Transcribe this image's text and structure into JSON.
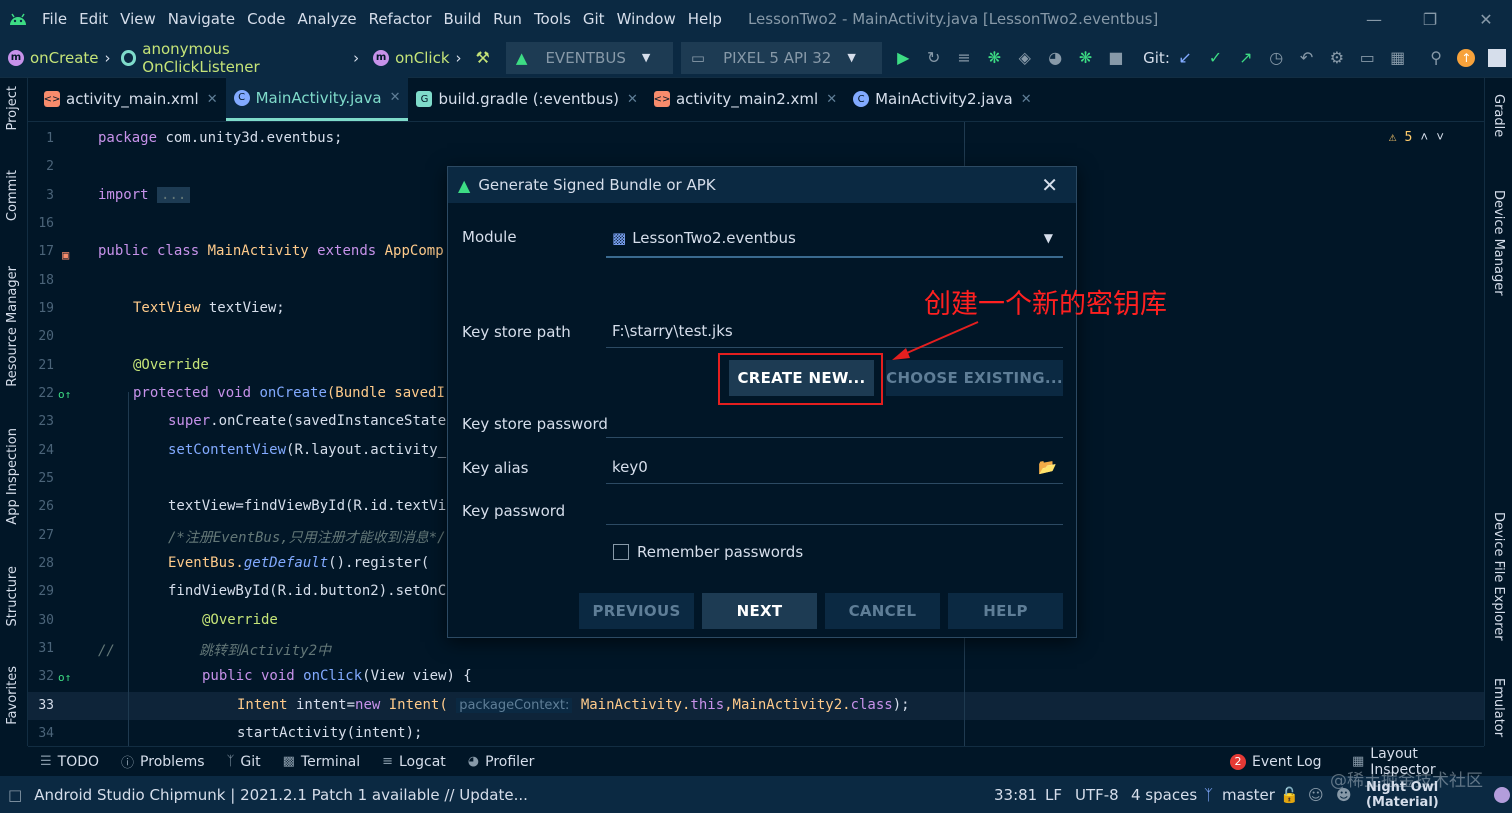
{
  "menubar": {
    "items": [
      "File",
      "Edit",
      "View",
      "Navigate",
      "Code",
      "Analyze",
      "Refactor",
      "Build",
      "Run",
      "Tools",
      "Git",
      "Window",
      "Help"
    ],
    "title": "LessonTwo2 - MainActivity.java [LessonTwo2.eventbus]"
  },
  "toolbar": {
    "crumbs": [
      "onCreate",
      "anonymous OnClickListener",
      "onClick"
    ],
    "run_config": "EVENTBUS",
    "device": "PIXEL 5 API 32",
    "git_label": "Git:"
  },
  "tabs": [
    {
      "label": "activity_main.xml",
      "type": "xml"
    },
    {
      "label": "MainActivity.java",
      "type": "java",
      "active": true
    },
    {
      "label": "build.gradle (:eventbus)",
      "type": "gradle"
    },
    {
      "label": "activity_main2.xml",
      "type": "xml"
    },
    {
      "label": "MainActivity2.java",
      "type": "java"
    }
  ],
  "left_tools": [
    "Project",
    "Commit",
    "Resource Manager",
    "App Inspection",
    "Structure",
    "Favorites"
  ],
  "right_tools": [
    "Gradle",
    "Device Manager",
    "Device File Explorer",
    "Emulator"
  ],
  "editor": {
    "warnings": "5",
    "line_numbers": [
      "1",
      "2",
      "3",
      "16",
      "17",
      "18",
      "19",
      "20",
      "21",
      "22",
      "23",
      "24",
      "25",
      "26",
      "27",
      "28",
      "29",
      "30",
      "31",
      "32",
      "33",
      "34"
    ],
    "lines": {
      "l1_kw": "package",
      "l1_rest": " com.unity3d.eventbus;",
      "l3_kw": "import",
      "l3_fold": "...",
      "l17_kw": "public class",
      "l17_name": " MainActivity ",
      "l17_ext": "extends",
      "l17_rest": " AppComp",
      "l19_type": "TextView",
      "l19_rest": " textView;",
      "l21_ann": "@Override",
      "l22_kw": "protected void",
      "l22_fn": " onCreate",
      "l22_rest": "(Bundle savedI",
      "l23_kw": "super",
      "l23_rest": ".onCreate(savedInstanceState",
      "l24_fn": "setContentView",
      "l24_rest": "(R.layout.activity_",
      "l26_rest": "textView=findViewById(R.id.textVi",
      "l27_cm": "/*注册EventBus,只用注册才能收到消息*/",
      "l28_rest": "EventBus.",
      "l28_it": "getDefault",
      "l28_rest2": "().register(",
      "l29_rest": "findViewById(R.id.button2).setOnC",
      "l30_ann": "@Override",
      "l31_cm": "//          跳转到Activity2中",
      "l32_kw": "public void",
      "l32_fn": " onClick",
      "l32_rest": "(View view) {",
      "l33_type": "Intent",
      "l33_mid": " intent=",
      "l33_new": "new",
      "l33_type2": " Intent(",
      "l33_hint": "packageContext:",
      "l33_rest": " MainActivity.",
      "l33_this": "this",
      "l33_rest2": ",MainActivity2.",
      "l33_class": "class",
      "l33_end": ");",
      "l34_rest": "startActivity(intent);"
    }
  },
  "bottom_tools": {
    "left": [
      "TODO",
      "Problems",
      "Git",
      "Terminal",
      "Logcat",
      "Profiler"
    ],
    "event_log": "Event Log",
    "event_count": "2",
    "layout_inspector": "Layout Inspector"
  },
  "statusbar": {
    "message": "Android Studio Chipmunk | 2021.2.1 Patch 1 available // Update...",
    "position": "33:81",
    "line_sep": "LF",
    "encoding": "UTF-8",
    "indent": "4 spaces",
    "branch": "master",
    "theme": "Night Owl (Material)"
  },
  "dialog": {
    "title": "Generate Signed Bundle or APK",
    "module_label": "Module",
    "module_value": "LessonTwo2.eventbus",
    "keystore_path_label": "Key store path",
    "keystore_path_value": "F:\\starry\\test.jks",
    "create_new": "CREATE NEW...",
    "choose_existing": "CHOOSE EXISTING...",
    "keystore_password_label": "Key store password",
    "key_alias_label": "Key alias",
    "key_alias_value": "key0",
    "key_password_label": "Key password",
    "remember": "Remember passwords",
    "remember_checked": false,
    "previous": "PREVIOUS",
    "next": "NEXT",
    "cancel": "CANCEL",
    "help": "HELP"
  },
  "annotation": {
    "text": "创建一个新的密钥库",
    "color": "#ff2020"
  },
  "watermark": "@稀土掘金技术社区"
}
